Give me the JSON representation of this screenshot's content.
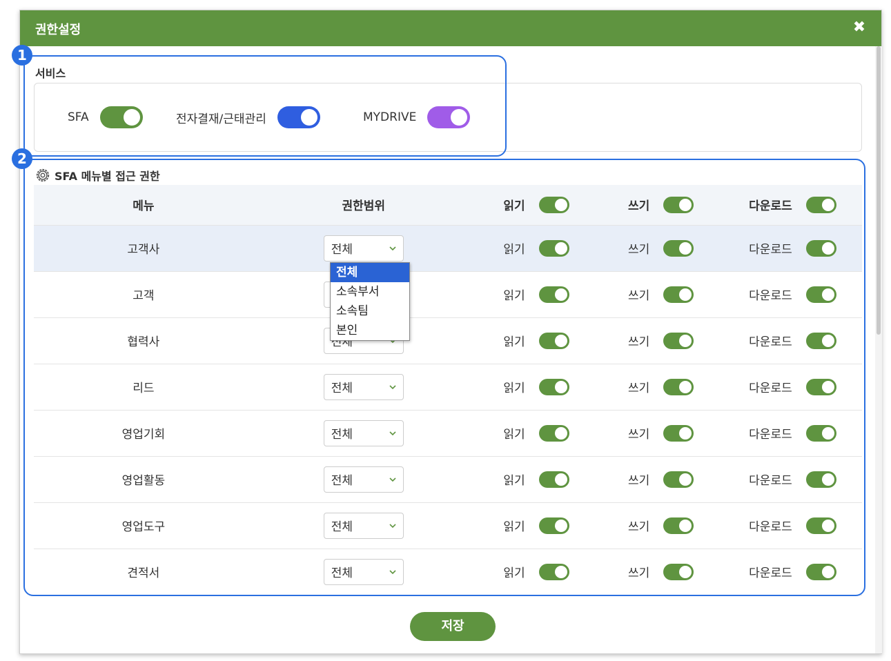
{
  "modal": {
    "title": "권한설정",
    "save_label": "저장"
  },
  "badges": [
    "1",
    "2"
  ],
  "services": {
    "label": "서비스",
    "items": [
      {
        "label": "SFA",
        "on": true,
        "color": "#5f9440"
      },
      {
        "label": "전자결재/근태관리",
        "on": true,
        "color": "#2f5ee0"
      },
      {
        "label": "MYDRIVE",
        "on": true,
        "color": "#a05ce8"
      }
    ]
  },
  "menu_access": {
    "title": "SFA 메뉴별 접근 권한",
    "header": {
      "menu": "메뉴",
      "scope": "권한범위",
      "read": "읽기",
      "write": "쓰기",
      "download": "다운로드"
    },
    "rows": [
      {
        "menu": "고객사",
        "scope": "전체",
        "read": "읽기",
        "write": "쓰기",
        "download": "다운로드"
      },
      {
        "menu": "고객",
        "scope": "전체",
        "read": "읽기",
        "write": "쓰기",
        "download": "다운로드"
      },
      {
        "menu": "협력사",
        "scope": "전체",
        "read": "읽기",
        "write": "쓰기",
        "download": "다운로드"
      },
      {
        "menu": "리드",
        "scope": "전체",
        "read": "읽기",
        "write": "쓰기",
        "download": "다운로드"
      },
      {
        "menu": "영업기회",
        "scope": "전체",
        "read": "읽기",
        "write": "쓰기",
        "download": "다운로드"
      },
      {
        "menu": "영업활동",
        "scope": "전체",
        "read": "읽기",
        "write": "쓰기",
        "download": "다운로드"
      },
      {
        "menu": "영업도구",
        "scope": "전체",
        "read": "읽기",
        "write": "쓰기",
        "download": "다운로드"
      },
      {
        "menu": "견적서",
        "scope": "전체",
        "read": "읽기",
        "write": "쓰기",
        "download": "다운로드"
      }
    ],
    "scope_options": [
      "전체",
      "소속부서",
      "소속팀",
      "본인"
    ]
  }
}
